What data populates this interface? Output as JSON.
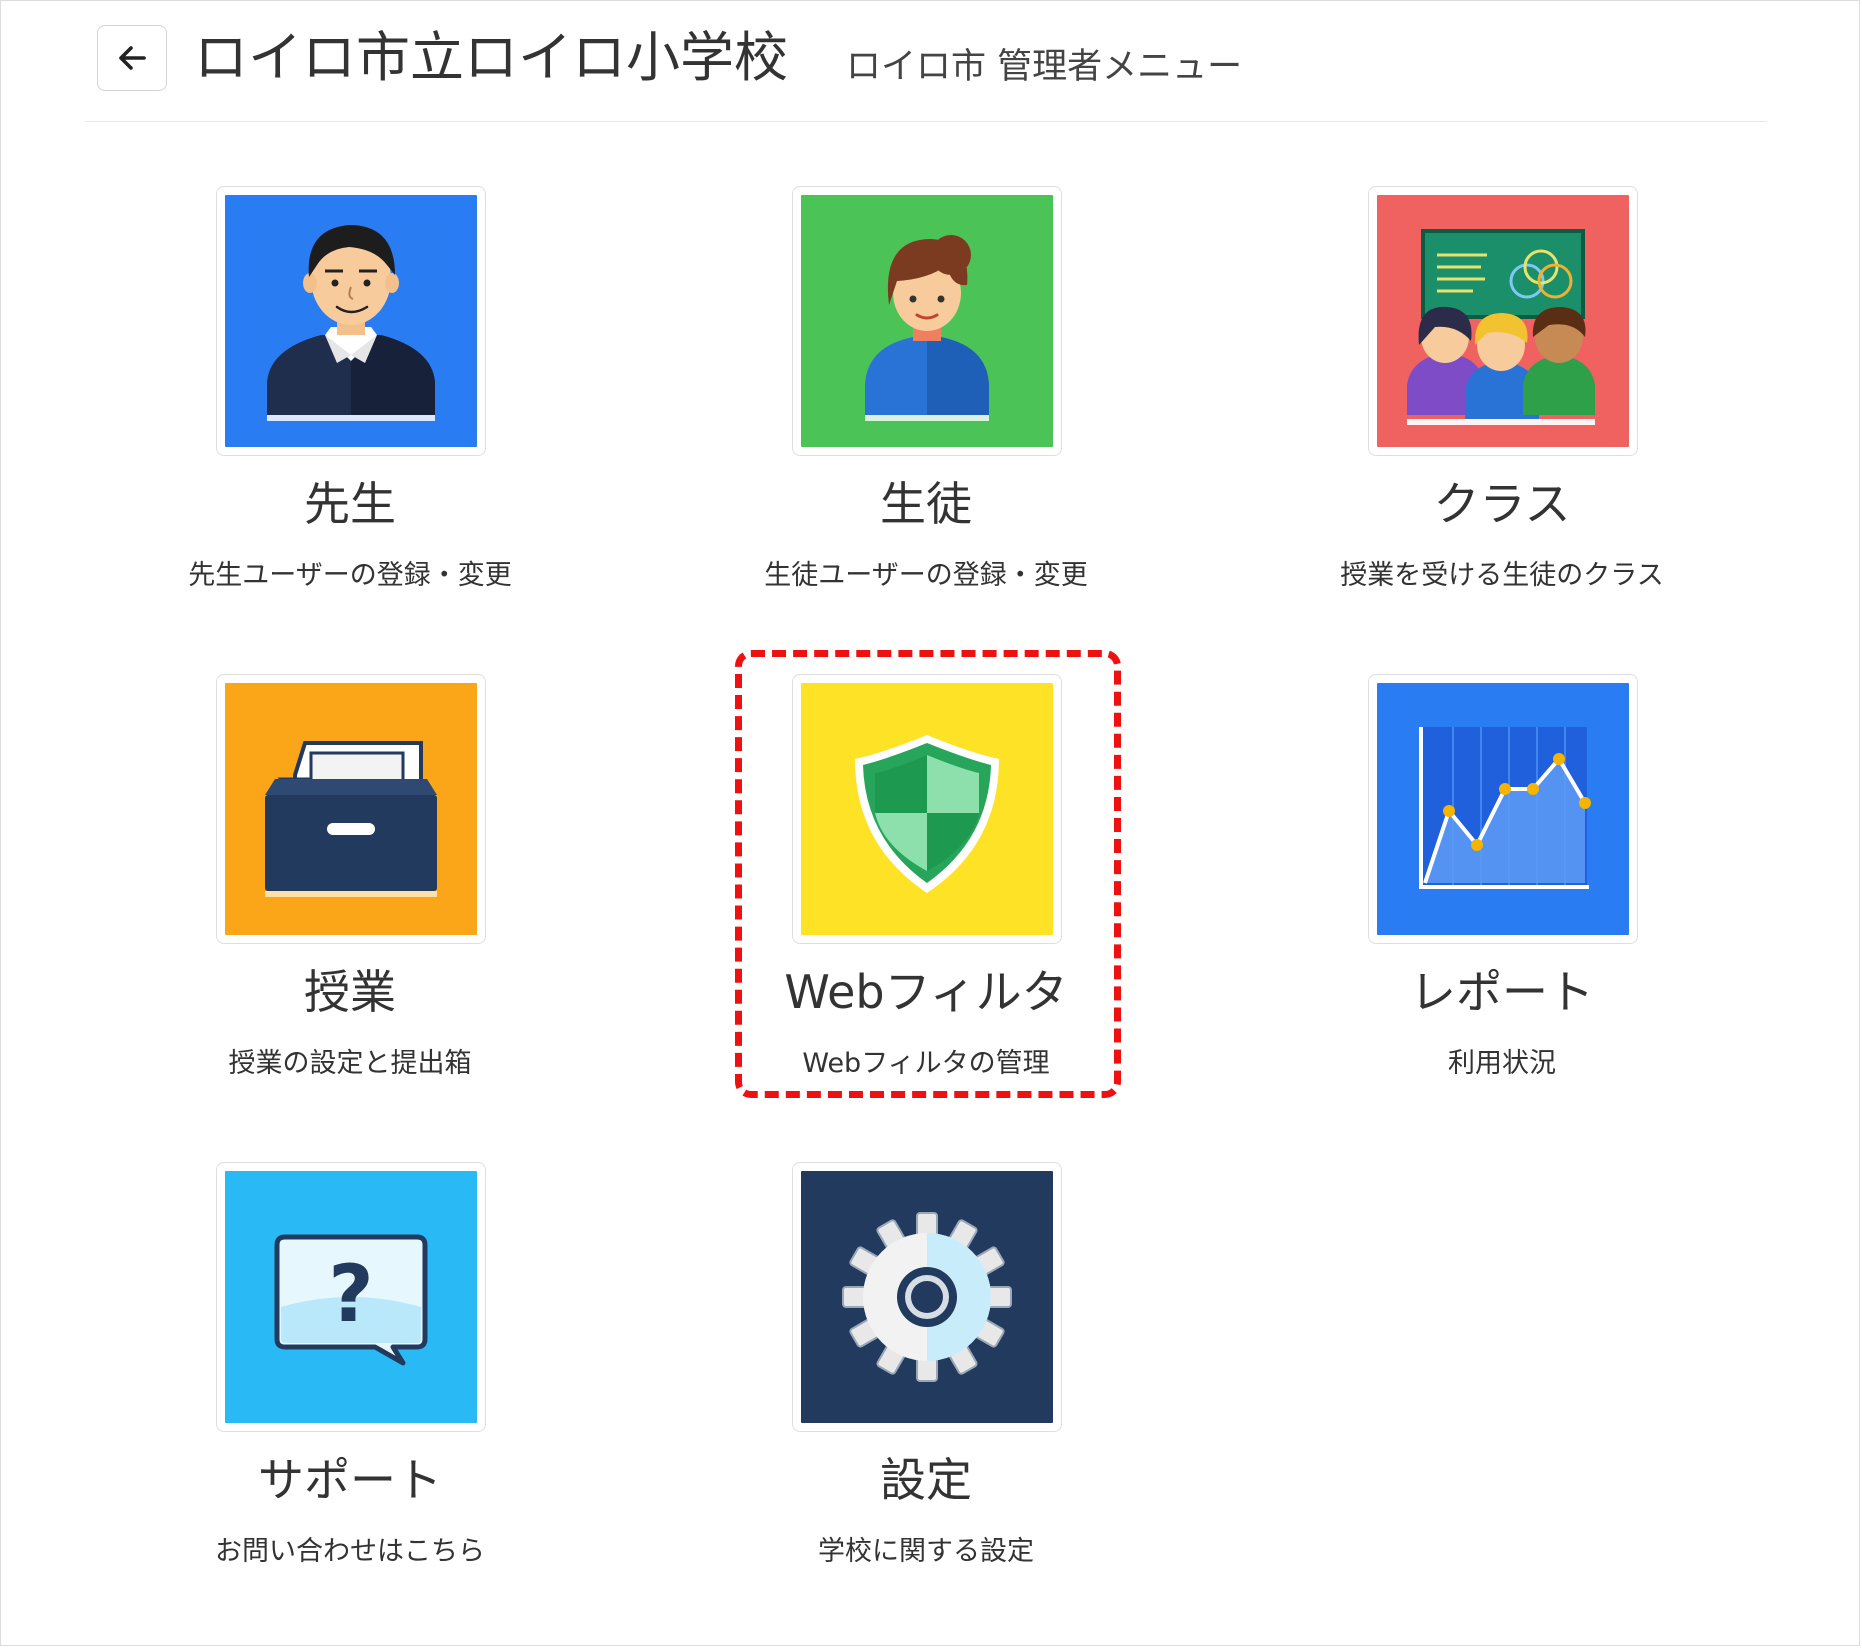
{
  "header": {
    "back_icon": "arrow-left-icon",
    "title": "ロイロ市立ロイロ小学校",
    "subtitle": "ロイロ市 管理者メニュー"
  },
  "menu": [
    {
      "id": "teacher",
      "title": "先生",
      "desc": "先生ユーザーの登録・変更",
      "icon": "teacher-icon",
      "color": "#2a7cf2"
    },
    {
      "id": "student",
      "title": "生徒",
      "desc": "生徒ユーザーの登録・変更",
      "icon": "student-icon",
      "color": "#4bc356"
    },
    {
      "id": "class",
      "title": "クラス",
      "desc": "授業を受ける生徒のクラス",
      "icon": "classroom-icon",
      "color": "#f0625f"
    },
    {
      "id": "lesson",
      "title": "授業",
      "desc": "授業の設定と提出箱",
      "icon": "drawer-icon",
      "color": "#fba518"
    },
    {
      "id": "webfilter",
      "title": "Webフィルタ",
      "desc": "Webフィルタの管理",
      "icon": "shield-icon",
      "color": "#fde226"
    },
    {
      "id": "report",
      "title": "レポート",
      "desc": "利用状況",
      "icon": "line-chart-icon",
      "color": "#2a7cf2"
    },
    {
      "id": "support",
      "title": "サポート",
      "desc": "お問い合わせはこちら",
      "icon": "question-bubble-icon",
      "color": "#29baf6"
    },
    {
      "id": "settings",
      "title": "設定",
      "desc": "学校に関する設定",
      "icon": "gear-icon",
      "color": "#223a5e"
    }
  ],
  "highlight_color": "#ee1111"
}
